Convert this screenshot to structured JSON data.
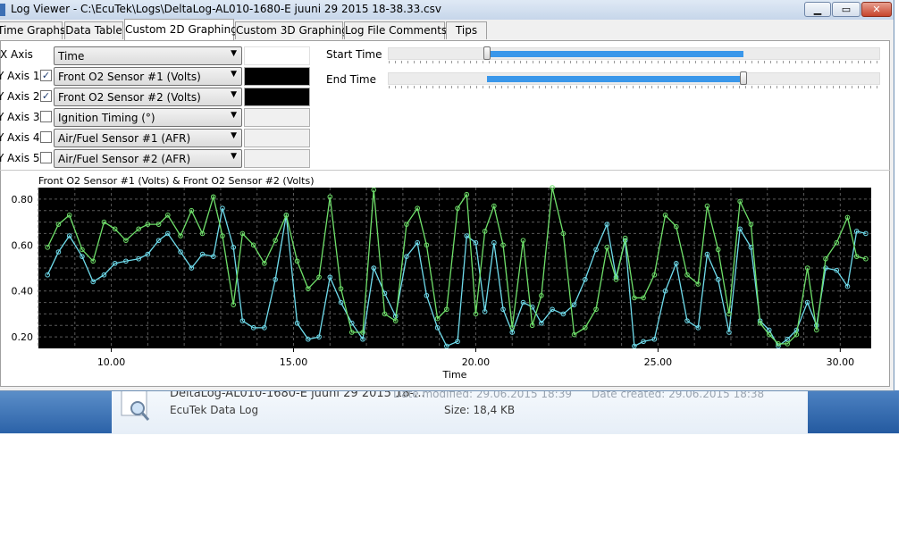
{
  "window": {
    "title": "Log Viewer - C:\\EcuTek\\Logs\\DeltaLog-AL010-1680-E juuni 29 2015 18-38.33.csv",
    "buttons": {
      "minimize": "▁",
      "maximize": "▭",
      "close": "✕"
    }
  },
  "tabs": [
    {
      "label": "Time Graphs",
      "active": false
    },
    {
      "label": "Data Table",
      "active": false
    },
    {
      "label": "Custom 2D Graphing",
      "active": true
    },
    {
      "label": "Custom 3D Graphing",
      "active": false
    },
    {
      "label": "Log File Comments",
      "active": false
    },
    {
      "label": "Tips",
      "active": false
    }
  ],
  "axes": {
    "x_label": "X Axis",
    "x_value": "Time",
    "y": [
      {
        "label": "Y Axis 1",
        "checked": true,
        "value": "Front O2 Sensor #1 (Volts)",
        "color": "#000000"
      },
      {
        "label": "Y Axis 2",
        "checked": true,
        "value": "Front O2 Sensor #2 (Volts)",
        "color": "#000000"
      },
      {
        "label": "Y Axis 3",
        "checked": false,
        "value": "Ignition Timing (°)",
        "color": ""
      },
      {
        "label": "Y Axis 4",
        "checked": false,
        "value": "Air/Fuel Sensor #1 (AFR)",
        "color": ""
      },
      {
        "label": "Y Axis 5",
        "checked": false,
        "value": "Air/Fuel Sensor #2 (AFR)",
        "color": ""
      }
    ]
  },
  "sliders": {
    "start_label": "Start Time",
    "end_label": "End Time",
    "start_position": 0.2,
    "end_position": 0.72
  },
  "explorer": {
    "filename": "DeltaLog-AL010-1680-E juuni 29 2015 18-...",
    "date_modified": "Date modified: 29.06.2015 18:39",
    "date_created": "Date created: 29.06.2015 18:38",
    "type": "EcuTek Data Log",
    "size": "Size: 18,4 KB"
  },
  "chart_data": {
    "type": "line",
    "title": "Front O2 Sensor  #1 (Volts) & Front O2 Sensor  #2 (Volts)",
    "xlabel": "Time",
    "ylabel": "",
    "xlim": [
      8.0,
      30.85
    ],
    "ylim": [
      0.15,
      0.85
    ],
    "x_ticks": [
      10.0,
      15.0,
      20.0,
      25.0,
      30.0
    ],
    "x_tick_labels": [
      "10.00",
      "15.00",
      "20.00",
      "25.00",
      "30.00"
    ],
    "y_ticks": [
      0.2,
      0.4,
      0.6,
      0.8
    ],
    "y_tick_labels": [
      "0.20",
      "0.40",
      "0.60",
      "0.80"
    ],
    "background": "#000000",
    "grid": true,
    "series": [
      {
        "color": "#6fdcec",
        "x": [
          8.25,
          8.55,
          8.85,
          9.2,
          9.5,
          9.8,
          10.1,
          10.4,
          10.75,
          11.0,
          11.3,
          11.55,
          11.9,
          12.2,
          12.5,
          12.8,
          13.05,
          13.35,
          13.6,
          13.9,
          14.2,
          14.5,
          14.8,
          15.1,
          15.4,
          15.7,
          16.0,
          16.3,
          16.6,
          16.9,
          17.2,
          17.5,
          17.8,
          18.1,
          18.4,
          18.65,
          18.95,
          19.2,
          19.5,
          19.75,
          20.0,
          20.25,
          20.5,
          20.75,
          21.0,
          21.3,
          21.55,
          21.8,
          22.1,
          22.4,
          22.7,
          23.0,
          23.3,
          23.6,
          23.85,
          24.1,
          24.35,
          24.6,
          24.9,
          25.2,
          25.5,
          25.8,
          26.1,
          26.35,
          26.65,
          26.95,
          27.25,
          27.55,
          27.8,
          28.05,
          28.3,
          28.55,
          28.8,
          29.1,
          29.35,
          29.6,
          29.9,
          30.2,
          30.45,
          30.7
        ],
        "y": [
          0.47,
          0.57,
          0.64,
          0.55,
          0.44,
          0.47,
          0.52,
          0.53,
          0.54,
          0.56,
          0.62,
          0.65,
          0.57,
          0.5,
          0.56,
          0.55,
          0.76,
          0.59,
          0.27,
          0.24,
          0.24,
          0.45,
          0.73,
          0.26,
          0.19,
          0.2,
          0.46,
          0.35,
          0.26,
          0.19,
          0.5,
          0.39,
          0.29,
          0.55,
          0.61,
          0.38,
          0.24,
          0.16,
          0.18,
          0.64,
          0.61,
          0.31,
          0.61,
          0.32,
          0.22,
          0.35,
          0.33,
          0.26,
          0.32,
          0.3,
          0.34,
          0.45,
          0.58,
          0.69,
          0.46,
          0.62,
          0.16,
          0.18,
          0.19,
          0.4,
          0.52,
          0.27,
          0.24,
          0.56,
          0.45,
          0.22,
          0.67,
          0.59,
          0.27,
          0.23,
          0.16,
          0.19,
          0.23,
          0.35,
          0.25,
          0.5,
          0.49,
          0.42,
          0.66,
          0.65
        ]
      },
      {
        "color": "#6fe06a",
        "x": [
          8.25,
          8.55,
          8.85,
          9.2,
          9.5,
          9.8,
          10.1,
          10.4,
          10.75,
          11.0,
          11.3,
          11.55,
          11.9,
          12.2,
          12.5,
          12.8,
          13.05,
          13.35,
          13.6,
          13.9,
          14.2,
          14.5,
          14.8,
          15.1,
          15.4,
          15.7,
          16.0,
          16.3,
          16.6,
          16.9,
          17.2,
          17.5,
          17.8,
          18.1,
          18.4,
          18.65,
          18.95,
          19.2,
          19.5,
          19.75,
          20.0,
          20.25,
          20.5,
          20.75,
          21.0,
          21.3,
          21.55,
          21.8,
          22.1,
          22.4,
          22.7,
          23.0,
          23.3,
          23.6,
          23.85,
          24.1,
          24.35,
          24.6,
          24.9,
          25.2,
          25.5,
          25.8,
          26.1,
          26.35,
          26.65,
          26.95,
          27.25,
          27.55,
          27.8,
          28.05,
          28.3,
          28.55,
          28.8,
          29.1,
          29.35,
          29.6,
          29.9,
          30.2,
          30.45,
          30.7
        ],
        "y": [
          0.59,
          0.69,
          0.73,
          0.58,
          0.53,
          0.7,
          0.67,
          0.62,
          0.67,
          0.69,
          0.69,
          0.73,
          0.64,
          0.75,
          0.65,
          0.81,
          0.64,
          0.34,
          0.65,
          0.6,
          0.52,
          0.62,
          0.73,
          0.53,
          0.41,
          0.46,
          0.81,
          0.41,
          0.22,
          0.22,
          0.84,
          0.3,
          0.27,
          0.69,
          0.76,
          0.6,
          0.28,
          0.32,
          0.76,
          0.82,
          0.3,
          0.66,
          0.77,
          0.6,
          0.24,
          0.62,
          0.25,
          0.38,
          0.85,
          0.65,
          0.21,
          0.24,
          0.32,
          0.59,
          0.45,
          0.63,
          0.37,
          0.37,
          0.47,
          0.73,
          0.68,
          0.47,
          0.43,
          0.77,
          0.58,
          0.3,
          0.79,
          0.69,
          0.26,
          0.21,
          0.17,
          0.17,
          0.21,
          0.5,
          0.23,
          0.54,
          0.61,
          0.72,
          0.55,
          0.54
        ]
      }
    ]
  }
}
